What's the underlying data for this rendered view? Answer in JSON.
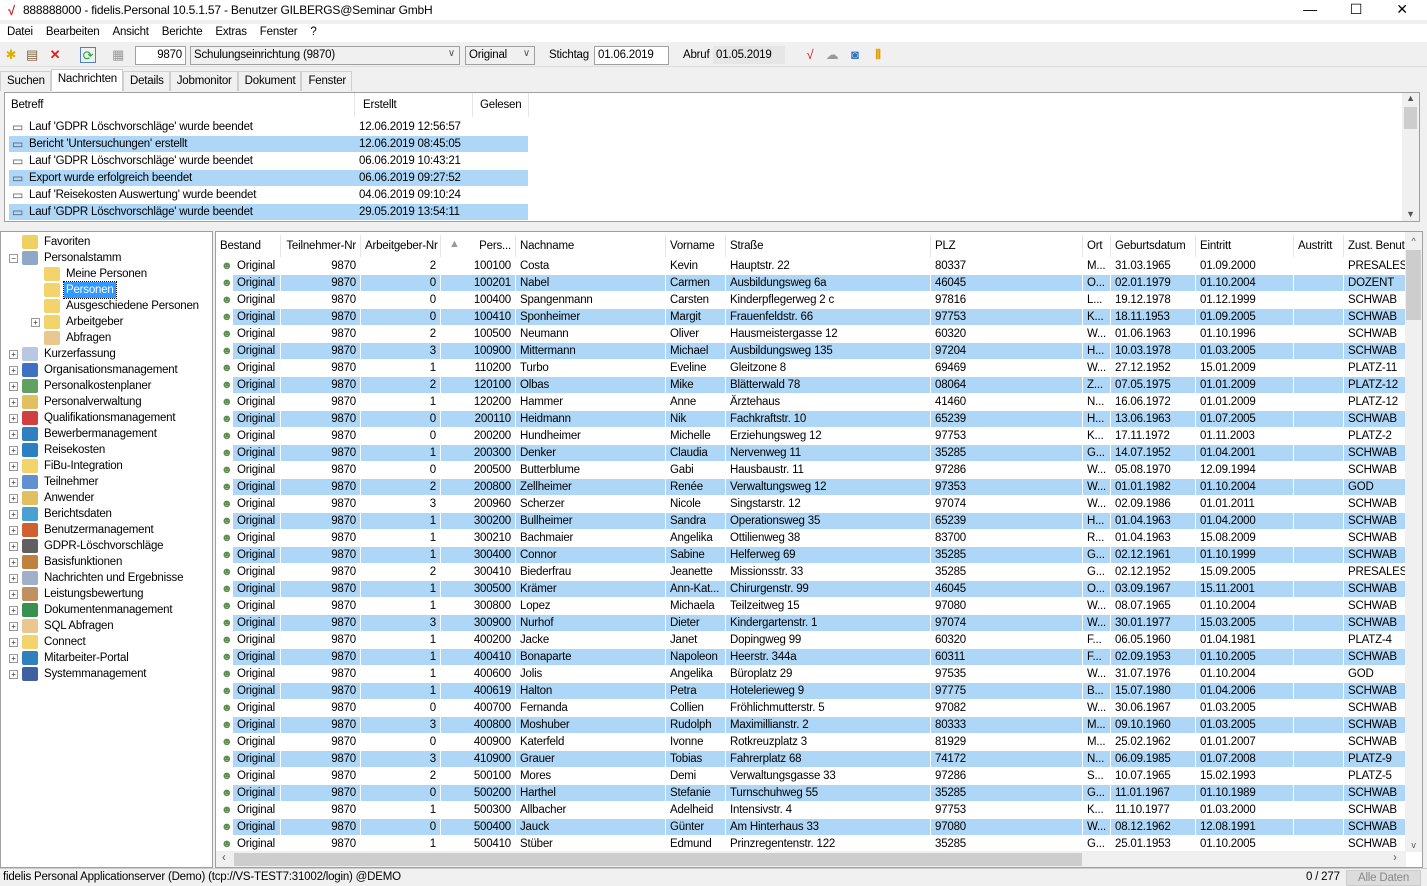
{
  "window": {
    "title": "888888000 - fidelis.Personal 10.5.1.57 - Benutzer GILBERGS@Seminar GmbH",
    "minimize": "—",
    "maximize": "☐",
    "close": "✕"
  },
  "menu": [
    "Datei",
    "Bearbeiten",
    "Ansicht",
    "Berichte",
    "Extras",
    "Fenster",
    "?"
  ],
  "toolbar": {
    "client_no": "9870",
    "client_name": "Schulungseinrichtung (9870)",
    "version": "Original",
    "stichtag_label": "Stichtag",
    "stichtag": "01.06.2019",
    "abruf_label": "Abruf",
    "abruf": "01.05.2019"
  },
  "tabs": [
    "Suchen",
    "Nachrichten",
    "Details",
    "Jobmonitor",
    "Dokument",
    "Fenster"
  ],
  "messages": {
    "headers": [
      "Betreff",
      "Erstellt",
      "Gelesen"
    ],
    "rows": [
      [
        "Lauf 'GDPR Löschvorschläge' wurde beendet",
        "12.06.2019 12:56:57",
        ""
      ],
      [
        "Bericht 'Untersuchungen' erstellt",
        "12.06.2019 08:45:05",
        ""
      ],
      [
        "Lauf 'GDPR Löschvorschläge' wurde beendet",
        "06.06.2019 10:43:21",
        ""
      ],
      [
        "Export wurde erfolgreich beendet",
        "06.06.2019 09:27:52",
        ""
      ],
      [
        "Lauf 'Reisekosten Auswertung' wurde beendet",
        "04.06.2019 09:10:24",
        ""
      ],
      [
        "Lauf 'GDPR Löschvorschläge' wurde beendet",
        "29.05.2019 13:54:11",
        ""
      ]
    ]
  },
  "tree": [
    {
      "label": "Favoriten",
      "level": 0,
      "exp": "",
      "color": "#f0d060"
    },
    {
      "label": "Personalstamm",
      "level": 0,
      "exp": "-",
      "color": "#8fa8c8"
    },
    {
      "label": "Meine Personen",
      "level": 1,
      "exp": "",
      "color": "#f3d36b"
    },
    {
      "label": "Personen",
      "level": 1,
      "exp": "",
      "color": "#f3d36b",
      "selected": true
    },
    {
      "label": "Ausgeschiedene Personen",
      "level": 1,
      "exp": "",
      "color": "#f3d36b"
    },
    {
      "label": "Arbeitgeber",
      "level": 1,
      "exp": "+",
      "color": "#f3d36b"
    },
    {
      "label": "Abfragen",
      "level": 1,
      "exp": "",
      "color": "#e8c890"
    },
    {
      "label": "Kurzerfassung",
      "level": 0,
      "exp": "+",
      "color": "#b8c8e0"
    },
    {
      "label": "Organisationsmanagement",
      "level": 0,
      "exp": "+",
      "color": "#4070c0"
    },
    {
      "label": "Personalkostenplaner",
      "level": 0,
      "exp": "+",
      "color": "#60a060"
    },
    {
      "label": "Personalverwaltung",
      "level": 0,
      "exp": "+",
      "color": "#e0c060"
    },
    {
      "label": "Qualifikationsmanagement",
      "level": 0,
      "exp": "+",
      "color": "#d04040"
    },
    {
      "label": "Bewerbermanagement",
      "level": 0,
      "exp": "+",
      "color": "#3080c0"
    },
    {
      "label": "Reisekosten",
      "level": 0,
      "exp": "+",
      "color": "#2a80c0"
    },
    {
      "label": "FiBu-Integration",
      "level": 0,
      "exp": "+",
      "color": "#f3d36b"
    },
    {
      "label": "Teilnehmer",
      "level": 0,
      "exp": "+",
      "color": "#6090d0"
    },
    {
      "label": "Anwender",
      "level": 0,
      "exp": "+",
      "color": "#e0c060"
    },
    {
      "label": "Berichtsdaten",
      "level": 0,
      "exp": "+",
      "color": "#4aa0d0"
    },
    {
      "label": "Benutzermanagement",
      "level": 0,
      "exp": "+",
      "color": "#d06030"
    },
    {
      "label": "GDPR-Löschvorschläge",
      "level": 0,
      "exp": "+",
      "color": "#606060"
    },
    {
      "label": "Basisfunktionen",
      "level": 0,
      "exp": "+",
      "color": "#c08040"
    },
    {
      "label": "Nachrichten und Ergebnisse",
      "level": 0,
      "exp": "+",
      "color": "#a0b0c8"
    },
    {
      "label": "Leistungsbewertung",
      "level": 0,
      "exp": "+",
      "color": "#c09060"
    },
    {
      "label": "Dokumentenmanagement",
      "level": 0,
      "exp": "+",
      "color": "#3a9050"
    },
    {
      "label": "SQL Abfragen",
      "level": 0,
      "exp": "+",
      "color": "#e8c890"
    },
    {
      "label": "Connect",
      "level": 0,
      "exp": "+",
      "color": "#f3d36b"
    },
    {
      "label": "Mitarbeiter-Portal",
      "level": 0,
      "exp": "+",
      "color": "#3080c0"
    },
    {
      "label": "Systemmanagement",
      "level": 0,
      "exp": "+",
      "color": "#4060a0"
    }
  ],
  "grid": {
    "headers": [
      "Bestand",
      "Teilnehmer-Nr",
      "Arbeitgeber-Nr",
      "Pers...",
      "Nachname",
      "Vorname",
      "Straße",
      "PLZ",
      "Ort",
      "Geburtsdatum",
      "Eintritt",
      "Austritt",
      "Zust. Benut:"
    ],
    "sort_icon": "▲",
    "rows": [
      [
        "Original",
        "9870",
        "2",
        "100100",
        "Costa",
        "Kevin",
        "Hauptstr. 22",
        "80337",
        "M...",
        "31.03.1965",
        "01.09.2000",
        "",
        "PRESALES"
      ],
      [
        "Original",
        "9870",
        "0",
        "100201",
        "Nabel",
        "Carmen",
        "Ausbildungsweg 6a",
        "46045",
        "O...",
        "02.01.1979",
        "01.10.2004",
        "",
        "DOZENT"
      ],
      [
        "Original",
        "9870",
        "0",
        "100400",
        "Spangenmann",
        "Carsten",
        "Kinderpflegerweg 2 c",
        "97816",
        "L...",
        "19.12.1978",
        "01.12.1999",
        "",
        "SCHWAB"
      ],
      [
        "Original",
        "9870",
        "0",
        "100410",
        "Sponheimer",
        "Margit",
        "Frauenfeldstr. 66",
        "97753",
        "K...",
        "18.11.1953",
        "01.09.2005",
        "",
        "SCHWAB"
      ],
      [
        "Original",
        "9870",
        "2",
        "100500",
        "Neumann",
        "Oliver",
        "Hausmeistergasse 12",
        "60320",
        "W...",
        "01.06.1963",
        "01.10.1996",
        "",
        "SCHWAB"
      ],
      [
        "Original",
        "9870",
        "3",
        "100900",
        "Mittermann",
        "Michael",
        "Ausbildungsweg 135",
        "97204",
        "H...",
        "10.03.1978",
        "01.03.2005",
        "",
        "SCHWAB"
      ],
      [
        "Original",
        "9870",
        "1",
        "110200",
        "Turbo",
        "Eveline",
        "Gleitzone 8",
        "69469",
        "W...",
        "27.12.1952",
        "15.01.2009",
        "",
        "PLATZ-11"
      ],
      [
        "Original",
        "9870",
        "2",
        "120100",
        "Olbas",
        "Mike",
        "Blätterwald 78",
        "08064",
        "Z...",
        "07.05.1975",
        "01.01.2009",
        "",
        "PLATZ-12"
      ],
      [
        "Original",
        "9870",
        "1",
        "120200",
        "Hammer",
        "Anne",
        "Ärztehaus",
        "41460",
        "N...",
        "16.06.1972",
        "01.01.2009",
        "",
        "PLATZ-12"
      ],
      [
        "Original",
        "9870",
        "0",
        "200110",
        "Heidmann",
        "Nik",
        "Fachkraftstr. 10",
        "65239",
        "H...",
        "13.06.1963",
        "01.07.2005",
        "",
        "SCHWAB"
      ],
      [
        "Original",
        "9870",
        "0",
        "200200",
        "Hundheimer",
        "Michelle",
        "Erziehungsweg 12",
        "97753",
        "K...",
        "17.11.1972",
        "01.11.2003",
        "",
        "PLATZ-2"
      ],
      [
        "Original",
        "9870",
        "1",
        "200300",
        "Denker",
        "Claudia",
        "Nervenweg 11",
        "35285",
        "G...",
        "14.07.1952",
        "01.04.2001",
        "",
        "SCHWAB"
      ],
      [
        "Original",
        "9870",
        "0",
        "200500",
        "Butterblume",
        "Gabi",
        "Hausbaustr. 11",
        "97286",
        "W...",
        "05.08.1970",
        "12.09.1994",
        "",
        "SCHWAB"
      ],
      [
        "Original",
        "9870",
        "2",
        "200800",
        "Zellheimer",
        "Renée",
        "Verwaltungsweg 12",
        "97353",
        "W...",
        "01.01.1982",
        "01.10.2004",
        "",
        "GOD"
      ],
      [
        "Original",
        "9870",
        "3",
        "200960",
        "Scherzer",
        "Nicole",
        "Singstarstr. 12",
        "97074",
        "W...",
        "02.09.1986",
        "01.01.2011",
        "",
        "SCHWAB"
      ],
      [
        "Original",
        "9870",
        "1",
        "300200",
        "Bullheimer",
        "Sandra",
        "Operationsweg 35",
        "65239",
        "H...",
        "01.04.1963",
        "01.04.2000",
        "",
        "SCHWAB"
      ],
      [
        "Original",
        "9870",
        "1",
        "300210",
        "Bachmaier",
        "Angelika",
        "Ottilienweg 38",
        "83700",
        "R...",
        "01.04.1963",
        "15.08.2009",
        "",
        "SCHWAB"
      ],
      [
        "Original",
        "9870",
        "1",
        "300400",
        "Connor",
        "Sabine",
        "Helferweg 69",
        "35285",
        "G...",
        "02.12.1961",
        "01.10.1999",
        "",
        "SCHWAB"
      ],
      [
        "Original",
        "9870",
        "2",
        "300410",
        "Biederfrau",
        "Jeanette",
        "Missionsstr. 33",
        "35285",
        "G...",
        "02.12.1952",
        "15.09.2005",
        "",
        "PRESALES"
      ],
      [
        "Original",
        "9870",
        "1",
        "300500",
        "Krämer",
        "Ann-Kat...",
        "Chirurgenstr. 99",
        "46045",
        "O...",
        "03.09.1967",
        "15.11.2001",
        "",
        "SCHWAB"
      ],
      [
        "Original",
        "9870",
        "1",
        "300800",
        "Lopez",
        "Michaela",
        "Teilzeitweg 15",
        "97080",
        "W...",
        "08.07.1965",
        "01.10.2004",
        "",
        "SCHWAB"
      ],
      [
        "Original",
        "9870",
        "3",
        "300900",
        "Nurhof",
        "Dieter",
        "Kindergartenstr. 1",
        "97074",
        "W...",
        "30.01.1977",
        "15.03.2005",
        "",
        "SCHWAB"
      ],
      [
        "Original",
        "9870",
        "1",
        "400200",
        "Jacke",
        "Janet",
        "Dopingweg 99",
        "60320",
        "F...",
        "06.05.1960",
        "01.04.1981",
        "",
        "PLATZ-4"
      ],
      [
        "Original",
        "9870",
        "1",
        "400410",
        "Bonaparte",
        "Napoleon",
        "Heerstr. 344a",
        "60311",
        "F...",
        "02.09.1953",
        "01.10.2005",
        "",
        "SCHWAB"
      ],
      [
        "Original",
        "9870",
        "1",
        "400600",
        "Jolis",
        "Angelika",
        "Büroplatz 29",
        "97535",
        "W...",
        "31.07.1976",
        "01.10.2004",
        "",
        "GOD"
      ],
      [
        "Original",
        "9870",
        "1",
        "400619",
        "Halton",
        "Petra",
        "Hotelerieweg 9",
        "97775",
        "B...",
        "15.07.1980",
        "01.04.2006",
        "",
        "SCHWAB"
      ],
      [
        "Original",
        "9870",
        "0",
        "400700",
        "Fernanda",
        "Collien",
        "Fröhlichmutterstr. 5",
        "97082",
        "W...",
        "30.06.1967",
        "01.03.2005",
        "",
        "SCHWAB"
      ],
      [
        "Original",
        "9870",
        "3",
        "400800",
        "Moshuber",
        "Rudolph",
        "Maximillianstr. 2",
        "80333",
        "M...",
        "09.10.1960",
        "01.03.2005",
        "",
        "SCHWAB"
      ],
      [
        "Original",
        "9870",
        "0",
        "400900",
        "Katerfeld",
        "Ivonne",
        "Rotkreuzplatz 3",
        "81929",
        "M...",
        "25.02.1962",
        "01.01.2007",
        "",
        "SCHWAB"
      ],
      [
        "Original",
        "9870",
        "3",
        "410900",
        "Grauer",
        "Tobias",
        "Fahrerplatz 68",
        "74172",
        "N...",
        "06.09.1985",
        "01.07.2008",
        "",
        "PLATZ-9"
      ],
      [
        "Original",
        "9870",
        "2",
        "500100",
        "Mores",
        "Demi",
        "Verwaltungsgasse 33",
        "97286",
        "S...",
        "10.07.1965",
        "15.02.1993",
        "",
        "PLATZ-5"
      ],
      [
        "Original",
        "9870",
        "0",
        "500200",
        "Harthel",
        "Stefanie",
        "Turnschuhweg 55",
        "35285",
        "G...",
        "11.01.1967",
        "01.10.1989",
        "",
        "SCHWAB"
      ],
      [
        "Original",
        "9870",
        "1",
        "500300",
        "Allbacher",
        "Adelheid",
        "Intensivstr. 4",
        "97753",
        "K...",
        "11.10.1977",
        "01.03.2000",
        "",
        "SCHWAB"
      ],
      [
        "Original",
        "9870",
        "0",
        "500400",
        "Jauck",
        "Günter",
        "Am Hinterhaus 33",
        "97080",
        "W...",
        "08.12.1962",
        "12.08.1991",
        "",
        "SCHWAB"
      ],
      [
        "Original",
        "9870",
        "1",
        "500410",
        "Stüber",
        "Edmund",
        "Prinzregentenstr. 122",
        "35285",
        "G...",
        "25.01.1953",
        "01.10.2005",
        "",
        "SCHWAB"
      ]
    ]
  },
  "status": {
    "server": "fidelis Personal Applicationserver (Demo) (tcp://VS-TEST7:31002/login) @DEMO",
    "count": "0 / 277",
    "filter": "Alle Daten"
  },
  "colors": {
    "selection": "#aed7f7",
    "tree_selection": "#3399ff"
  }
}
